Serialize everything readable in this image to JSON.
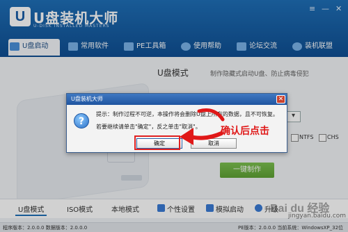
{
  "app": {
    "title": "U盘装机大师",
    "subtitle": "U-DISK INSTALLED MASTERS",
    "window_controls": [
      "≡",
      "—",
      "✕"
    ]
  },
  "nav": {
    "items": [
      {
        "label": "U盘启动",
        "icon": "usb-icon",
        "color": "#4a90d9"
      },
      {
        "label": "常用软件",
        "icon": "apps-icon",
        "color": "#7ab2e8"
      },
      {
        "label": "PE工具箱",
        "icon": "toolbox-icon",
        "color": "#7ab2e8"
      },
      {
        "label": "使用帮助",
        "icon": "help-icon",
        "color": "#7ab2e8"
      },
      {
        "label": "论坛交流",
        "icon": "forum-icon",
        "color": "#7ab2e8"
      },
      {
        "label": "装机联盟",
        "icon": "users-icon",
        "color": "#7ab2e8"
      }
    ]
  },
  "main": {
    "mode_title": "U盘模式",
    "mode_desc": "制作隐藏式启动U盘、防止病毒侵犯",
    "checkboxes": [
      "NTFS",
      "CHS"
    ],
    "make_button": "一键制作"
  },
  "tabs": {
    "items": [
      "U盘模式",
      "ISO模式",
      "本地模式"
    ],
    "settings": "个性设置",
    "simulate": "模拟启动",
    "upgrade": "升级"
  },
  "status": {
    "left": "程序版本：2.0.0.0  数据版本：2.0.0.0",
    "right": "PE版本：2.0.0.0 当前系统：WindowsXP_32位"
  },
  "dialog": {
    "title": "U盘装机大师",
    "close": "✕",
    "icon": "question-icon",
    "line1": "提示：制作过程不可逆，本操作将会删除U盘上所有的数据，且不可恢复。",
    "line2": "若要继续请单击\"确定\"，反之单击\"取消\"。",
    "ok": "确定",
    "cancel": "取消"
  },
  "annotation": {
    "text": "确认后点击",
    "color": "#e01818"
  },
  "watermark": {
    "logo": "Bai du",
    "brand": "经验",
    "url": "jingyan.baidu.com"
  },
  "colors": {
    "header": "#1f6fb7",
    "accent_green": "#5ea234",
    "highlight_red": "#e02020"
  }
}
